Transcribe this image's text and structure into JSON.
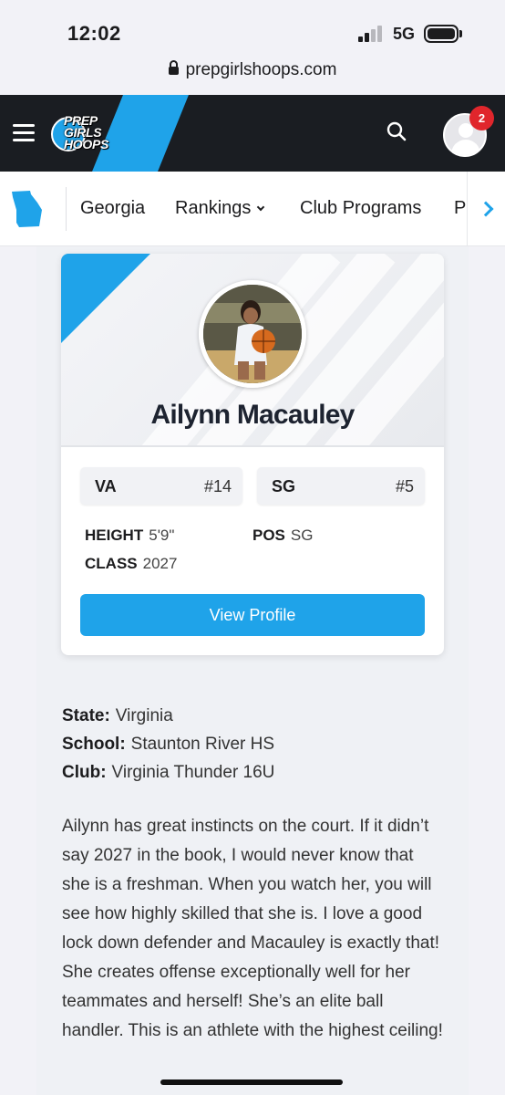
{
  "status_bar": {
    "time": "12:02",
    "network": "5G"
  },
  "browser": {
    "url": "prepgirlshoops.com"
  },
  "header": {
    "logo_lines": [
      "PREP",
      "GIRLS",
      "HOOPS"
    ],
    "notification_count": "2",
    "brand_color": "#1fa3e9"
  },
  "subnav": {
    "state_icon": "georgia-state-icon",
    "items": [
      "Georgia",
      "Rankings",
      "Club Programs",
      "P"
    ]
  },
  "profile_card": {
    "name": "Ailynn Macauley",
    "state_pill": {
      "label": "VA",
      "rank": "#14"
    },
    "position_pill": {
      "label": "SG",
      "rank": "#5"
    },
    "height_label": "HEIGHT",
    "height_value": "5'9\"",
    "pos_label": "POS",
    "pos_value": "SG",
    "class_label": "CLASS",
    "class_value": "2027",
    "button_label": "View Profile"
  },
  "details": {
    "state_label": "State:",
    "state_value": "Virginia",
    "school_label": "School:",
    "school_value": "Staunton River HS",
    "club_label": "Club:",
    "club_value": "Virginia Thunder 16U"
  },
  "bio": "Ailynn has great instincts on the court. If it didn’t say 2027 in the book, I would never know that she is a freshman. When you watch her, you will see how highly skilled that she is. I love a good lock down defender and Macauley is exactly that! She creates offense exceptionally well for her teammates and herself! She’s an elite ball handler. This is an athlete with the highest ceiling!"
}
